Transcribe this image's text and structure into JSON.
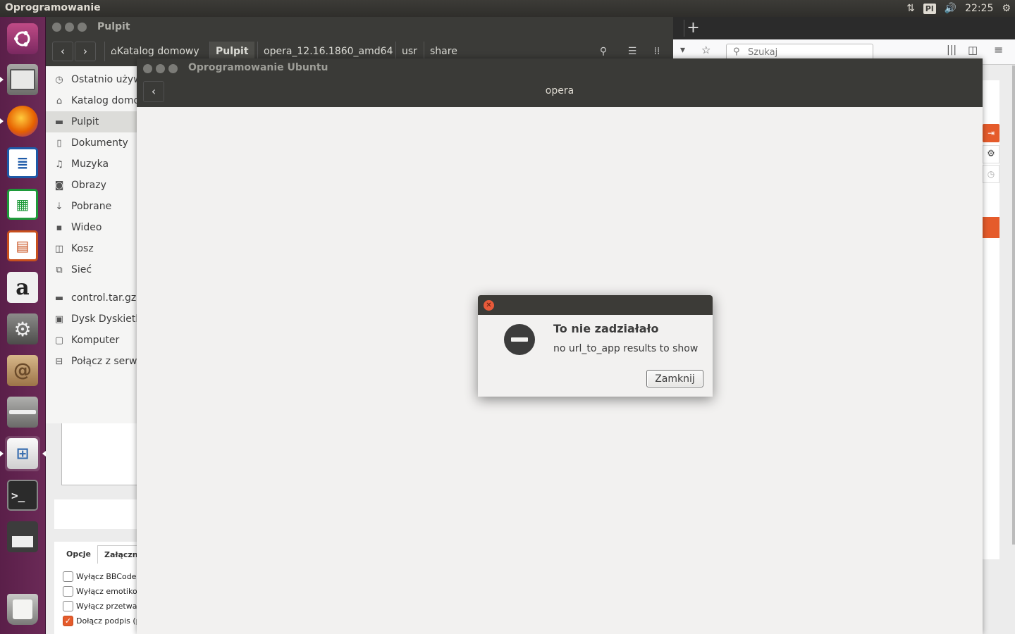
{
  "top_panel": {
    "app_title": "Oprogramowanie",
    "keyboard_layout": "Pl",
    "clock": "22:25",
    "icons": [
      "network-updown-icon",
      "volume-icon",
      "gear-icon"
    ]
  },
  "launcher": {
    "items": [
      {
        "name": "ubuntu-dash",
        "icon": "ubuntu-logo-icon",
        "color": "#e95420"
      },
      {
        "name": "files",
        "icon": "file-cabinet-icon",
        "color": "#8a8a88"
      },
      {
        "name": "firefox",
        "icon": "firefox-icon",
        "color": "#e66000"
      },
      {
        "name": "writer",
        "icon": "writer-icon",
        "color": "#1e5aa8"
      },
      {
        "name": "calc",
        "icon": "calc-icon",
        "color": "#1e9a3a"
      },
      {
        "name": "impress",
        "icon": "impress-icon",
        "color": "#c8501e"
      },
      {
        "name": "amazon",
        "icon": "amazon-icon",
        "color": "#f0f0f0"
      },
      {
        "name": "system-settings",
        "icon": "wrench-gear-icon",
        "color": "#6e6e6e"
      },
      {
        "name": "archive",
        "icon": "debian-box-icon",
        "color": "#b48a5a"
      },
      {
        "name": "usb-drive",
        "icon": "drive-icon",
        "color": "#8a8a8a"
      },
      {
        "name": "software",
        "icon": "shopping-bag-icon",
        "color": "#f2f2f2"
      },
      {
        "name": "terminal",
        "icon": "terminal-icon",
        "color": "#2b2b2b"
      },
      {
        "name": "save",
        "icon": "floppy-icon",
        "color": "#3c3c3c"
      },
      {
        "name": "trash",
        "icon": "trash-icon",
        "color": "#9a9a9a"
      }
    ]
  },
  "nautilus": {
    "title": "Pulpit",
    "breadcrumbs": [
      "Katalog domowy",
      "Pulpit",
      "opera_12.16.1860_amd64",
      "usr",
      "share"
    ],
    "sidebar": [
      {
        "label": "Ostatnio używane",
        "icon": "clock-icon"
      },
      {
        "label": "Katalog domowy",
        "icon": "home-icon"
      },
      {
        "label": "Pulpit",
        "icon": "folder-icon"
      },
      {
        "label": "Dokumenty",
        "icon": "document-icon"
      },
      {
        "label": "Muzyka",
        "icon": "music-icon"
      },
      {
        "label": "Obrazy",
        "icon": "camera-icon"
      },
      {
        "label": "Pobrane",
        "icon": "download-icon"
      },
      {
        "label": "Wideo",
        "icon": "video-icon"
      },
      {
        "label": "Kosz",
        "icon": "trash-icon"
      },
      {
        "label": "Sieć",
        "icon": "network-icon"
      },
      {
        "label": "control.tar.gz",
        "icon": "archive-drive-icon"
      },
      {
        "label": "Dysk Dyskietka",
        "icon": "floppy-disk-icon"
      },
      {
        "label": "Komputer",
        "icon": "computer-icon"
      },
      {
        "label": "Połącz z serwerem",
        "icon": "server-icon"
      }
    ]
  },
  "browser": {
    "search_placeholder": "Szukaj",
    "options_tabs": [
      "Opcje",
      "Załączniki"
    ],
    "options": [
      {
        "label": "Wyłącz BBCode",
        "checked": false
      },
      {
        "label": "Wyłącz emotikony",
        "checked": false
      },
      {
        "label": "Wyłącz przetwarzanie",
        "checked": false
      },
      {
        "label": "Dołącz podpis (po",
        "checked": true
      }
    ]
  },
  "software": {
    "window_title": "Oprogramowanie Ubuntu",
    "header_title": "opera"
  },
  "dialog": {
    "heading": "To nie zadziałało",
    "message": "no url_to_app results to show",
    "button_label": "Zamknij"
  }
}
